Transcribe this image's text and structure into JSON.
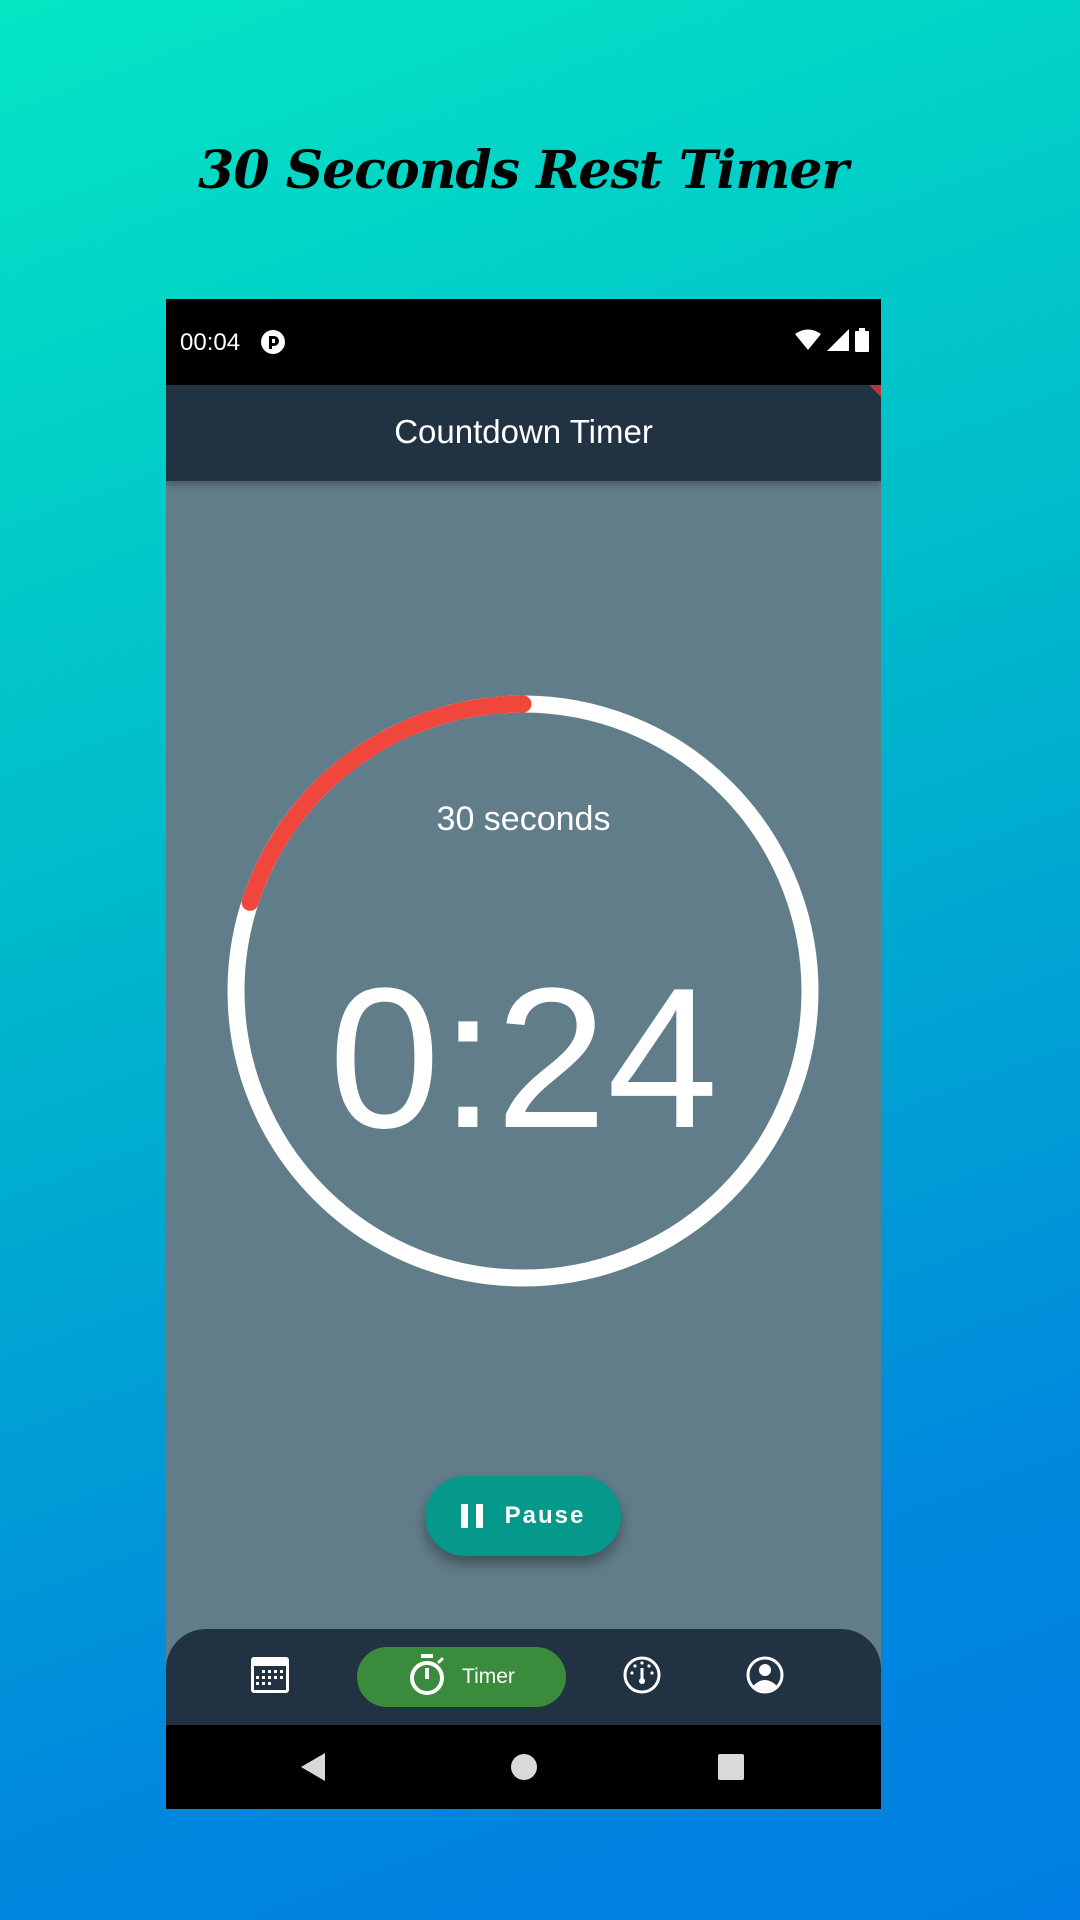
{
  "promo": {
    "title": "30 Seconds Rest Timer"
  },
  "status_bar": {
    "time": "00:04",
    "icons": [
      "app-notification-icon",
      "wifi-icon",
      "cellular-signal-icon",
      "battery-icon"
    ]
  },
  "app_bar": {
    "title": "Countdown Timer"
  },
  "timer": {
    "duration_label": "30 seconds",
    "remaining": "0:24",
    "elapsed_fraction": 0.2,
    "ring_color": "#ffffff",
    "progress_color": "#f0463c"
  },
  "controls": {
    "pause_label": "Pause",
    "pause_icon": "pause-icon"
  },
  "bottom_nav": {
    "items": [
      {
        "icon": "calendar-icon",
        "label": "",
        "active": false
      },
      {
        "icon": "stopwatch-icon",
        "label": "Timer",
        "active": true
      },
      {
        "icon": "gauge-icon",
        "label": "",
        "active": false
      },
      {
        "icon": "account-circle-icon",
        "label": "",
        "active": false
      }
    ],
    "active_color": "#3a8c3c"
  },
  "system_nav": {
    "buttons": [
      "back-icon",
      "home-icon",
      "recents-icon"
    ]
  },
  "colors": {
    "app_bar": "#213243",
    "background": "#627d8a",
    "button": "#06988a"
  }
}
